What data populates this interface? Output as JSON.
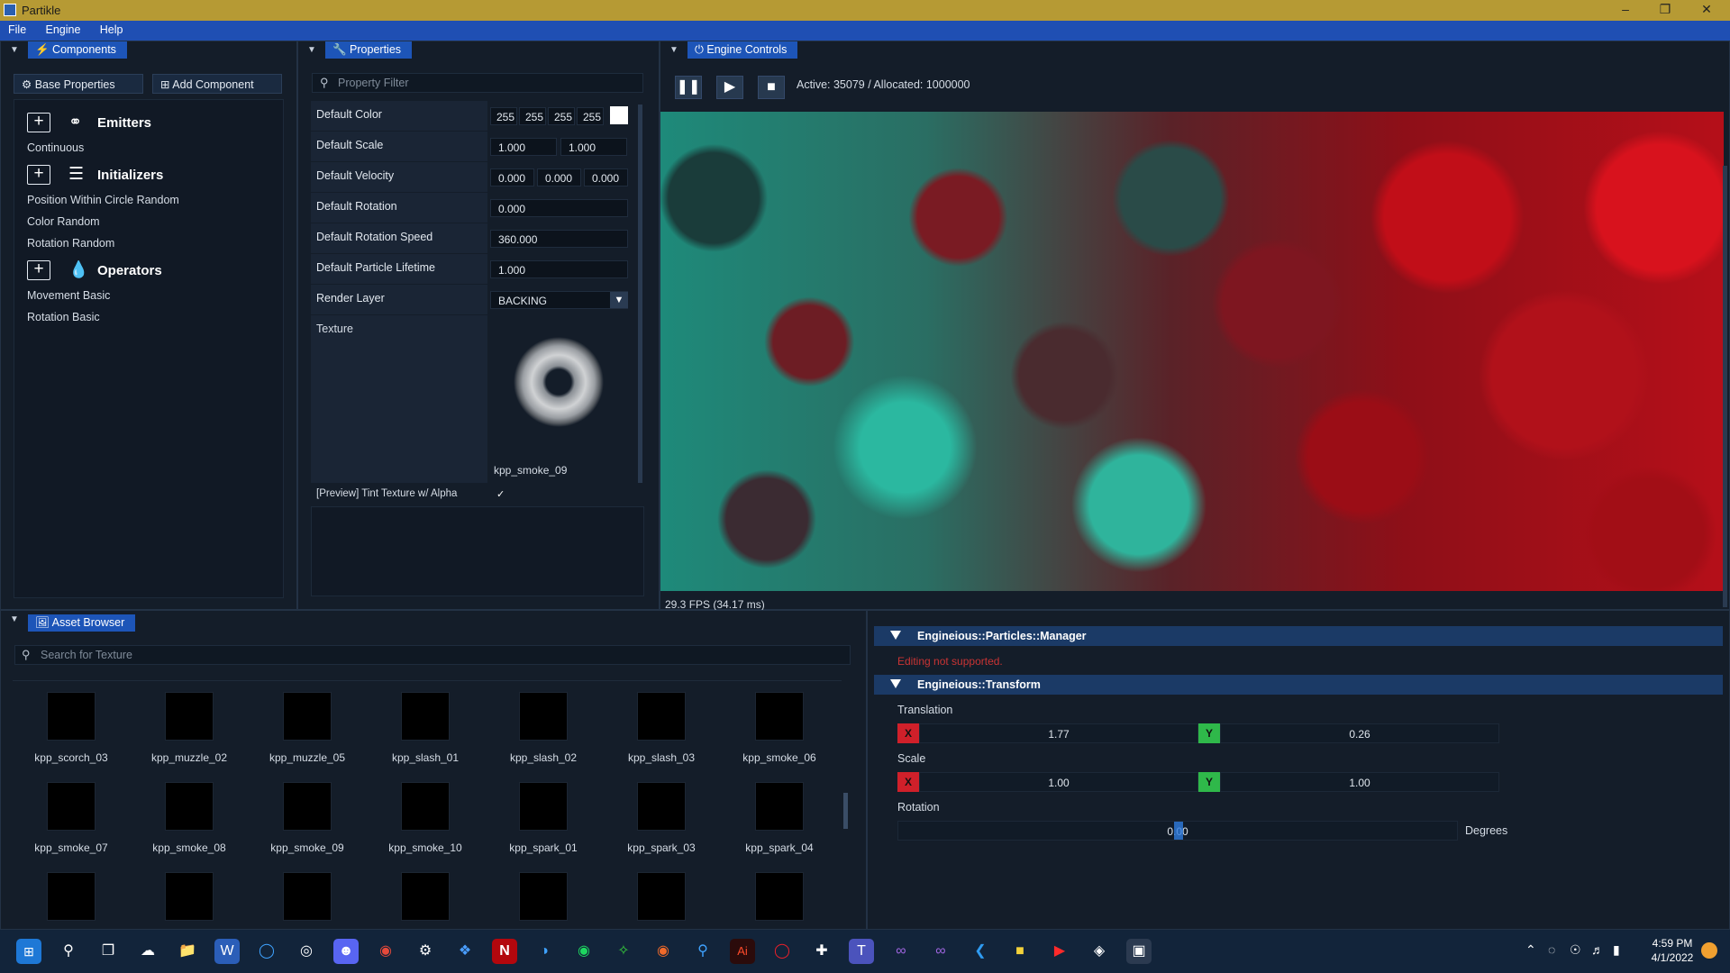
{
  "window": {
    "title": "Partikle"
  },
  "menu": [
    "File",
    "Engine",
    "Help"
  ],
  "components": {
    "tab": "Components",
    "base_btn": "Base Properties",
    "add_btn": "Add Component",
    "emitters": {
      "label": "Emitters",
      "items": [
        "Continuous"
      ]
    },
    "initializers": {
      "label": "Initializers",
      "items": [
        "Position Within Circle Random",
        "Color Random",
        "Rotation Random"
      ]
    },
    "operators": {
      "label": "Operators",
      "items": [
        "Movement Basic",
        "Rotation Basic"
      ]
    }
  },
  "properties": {
    "tab": "Properties",
    "filter_placeholder": "Property Filter",
    "rows": {
      "color": {
        "label": "Default Color",
        "values": [
          "255",
          "255",
          "255",
          "255"
        ]
      },
      "scale": {
        "label": "Default Scale",
        "values": [
          "1.000",
          "1.000"
        ]
      },
      "velocity": {
        "label": "Default Velocity",
        "values": [
          "0.000",
          "0.000",
          "0.000"
        ]
      },
      "rotation": {
        "label": "Default Rotation",
        "value": "0.000"
      },
      "rotspeed": {
        "label": "Default Rotation Speed",
        "value": "360.000"
      },
      "lifetime": {
        "label": "Default Particle Lifetime",
        "value": "1.000"
      },
      "layer": {
        "label": "Render Layer",
        "value": "BACKING"
      },
      "texture": {
        "label": "Texture",
        "name": "kpp_smoke_09"
      },
      "tint": {
        "label": "[Preview] Tint Texture w/ Alpha"
      }
    }
  },
  "engine": {
    "tab": "Engine Controls",
    "status": "Active: 35079 / Allocated: 1000000",
    "fps": "29.3 FPS (34.17 ms)"
  },
  "assets": {
    "tab": "Asset Browser",
    "search_placeholder": "Search for Texture",
    "row1": [
      "kpp_scorch_03",
      "kpp_muzzle_02",
      "kpp_muzzle_05",
      "kpp_slash_01",
      "kpp_slash_02",
      "kpp_slash_03",
      "kpp_smoke_06"
    ],
    "row2": [
      "kpp_smoke_07",
      "kpp_smoke_08",
      "kpp_smoke_09",
      "kpp_smoke_10",
      "kpp_spark_01",
      "kpp_spark_03",
      "kpp_spark_04"
    ]
  },
  "inspector": {
    "manager": {
      "title": "Engineious::Particles::Manager",
      "note": "Editing not supported."
    },
    "transform": {
      "title": "Engineious::Transform",
      "translation_label": "Translation",
      "tx": "1.77",
      "ty": "0.26",
      "scale_label": "Scale",
      "sx": "1.00",
      "sy": "1.00",
      "rotation_label": "Rotation",
      "rot": "0.00",
      "unit": "Degrees",
      "x": "X",
      "y": "Y"
    }
  },
  "taskbar": {
    "time": "4:59 PM",
    "date": "4/1/2022"
  },
  "colors": {
    "accent": "#1d55b8",
    "titlebar": "#b69a34",
    "x_axis": "#d0202a",
    "y_axis": "#2fb84a",
    "error": "#c93434"
  }
}
